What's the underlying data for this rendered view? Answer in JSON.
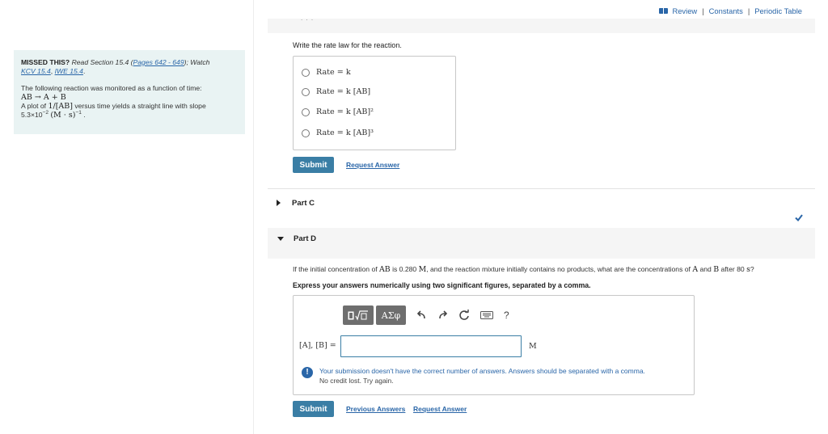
{
  "left_panel": {
    "missed_title": "MISSED THIS?",
    "read_text": "Read Section 15.4 (",
    "pages_link": "Pages 642 - 649",
    "watch_text": "); Watch",
    "kcv_link": "KCV 15.4",
    "comma": ",",
    "iwe_link": "IWE 15.4",
    "period": ".",
    "intro": "The following reaction was monitored as a function of time:",
    "reaction": "AB → A + B",
    "plot_text_1": "A plot of",
    "plot_math": "1/[AB]",
    "plot_text_2": "versus time yields a straight line with slope",
    "slope_value": "5.3×10",
    "slope_exp": "−2",
    "slope_units": "(M · s)",
    "slope_units_exp": "−1",
    "slope_end": "."
  },
  "top_links": {
    "review": "Review",
    "sep": "|",
    "constants": "Constants",
    "periodic_table": "Periodic Table"
  },
  "band_dots": ". . .",
  "part_b": {
    "prompt": "Write the rate law for the reaction.",
    "choices": [
      {
        "label": "Rate = k"
      },
      {
        "label": "Rate = k [AB]"
      },
      {
        "label": "Rate = k [AB]²"
      },
      {
        "label": "Rate = k [AB]³"
      }
    ],
    "submit_label": "Submit",
    "request_answer": "Request Answer"
  },
  "part_c": {
    "title": "Part C",
    "status_icon": "check-icon",
    "status_color": "#2a66a8"
  },
  "part_d": {
    "title": "Part D",
    "question_1": "If the initial concentration of",
    "question_ab": "AB",
    "question_2": "is 0.280",
    "question_m": "M",
    "question_3": ", and the reaction mixture initially contains no products, what are the concentrations of",
    "question_a": "A",
    "question_4": "and",
    "question_b": "B",
    "question_5": "after 80",
    "question_s": "s",
    "question_6": "?",
    "instruction": "Express your answers numerically using two significant figures, separated by a comma.",
    "toolbar": {
      "matrix_icon": "templates-icon",
      "greek_label": "ΑΣφ",
      "undo_icon": "undo-icon",
      "redo_icon": "redo-icon",
      "reset_icon": "reset-icon",
      "keyboard_icon": "keyboard-icon",
      "help_label": "?"
    },
    "answer_label": "[A], [B] =",
    "answer_value": "",
    "unit": "M",
    "feedback_line1": "Your submission doesn't have the correct number of answers. Answers should be separated with a comma.",
    "feedback_line2": "No credit lost. Try again.",
    "submit_label": "Submit",
    "previous_answers": "Previous Answers",
    "request_answer": "Request Answer"
  },
  "colors": {
    "accent": "#3a7ea5",
    "link": "#2a66a8",
    "panel_bg": "#e9f3f3"
  }
}
